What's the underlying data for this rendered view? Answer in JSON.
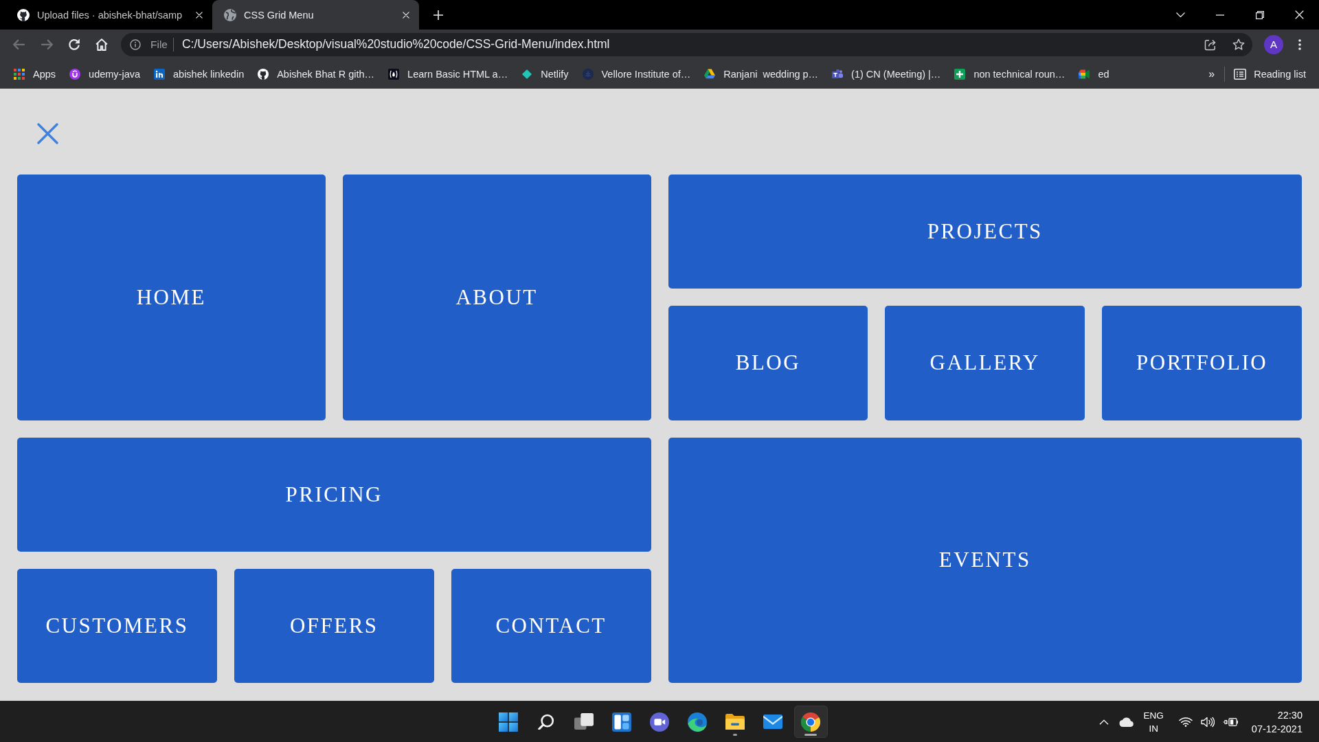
{
  "browser": {
    "tabs": [
      {
        "title": "Upload files · abishek-bhat/samp",
        "selected": false
      },
      {
        "title": "CSS Grid Menu",
        "selected": true
      }
    ],
    "toolbar": {
      "nav": [
        {
          "disabled": true
        },
        {
          "disabled": true
        },
        {
          "disabled": false
        },
        {
          "disabled": false
        }
      ],
      "address": {
        "scheme": "File",
        "url": "C:/Users/Abishek/Desktop/visual%20studio%20code/CSS-Grid-Menu/index.html"
      },
      "profile_initial": "A"
    },
    "bookmarks": {
      "items": [
        "Apps",
        "udemy-java",
        "abishek linkedin",
        "Abishek Bhat R gith…",
        "Learn Basic HTML a…",
        "Netlify",
        "Vellore Institute of…",
        "Ranjani  wedding p…",
        "(1) CN (Meeting) |…",
        "non technical roun…",
        "ed"
      ],
      "overflow": "»",
      "reading_list": "Reading list"
    }
  },
  "page": {
    "menu_items": [
      "HOME",
      "ABOUT",
      "PROJECTS",
      "BLOG",
      "GALLERY",
      "PORTFOLIO",
      "PRICING",
      "EVENTS",
      "CUSTOMERS",
      "OFFERS",
      "CONTACT"
    ]
  },
  "taskbar": {
    "apps": [
      {
        "running": false,
        "selected": false
      },
      {
        "running": false,
        "selected": false
      },
      {
        "running": false,
        "selected": false
      },
      {
        "running": false,
        "selected": false
      },
      {
        "running": false,
        "selected": false
      },
      {
        "running": false,
        "selected": false
      },
      {
        "running": true,
        "selected": false
      },
      {
        "running": false,
        "selected": false
      },
      {
        "running": true,
        "selected": true
      }
    ],
    "tray": {
      "language": "ENG",
      "region": "IN",
      "time": "22:30",
      "date": "07-12-2021"
    }
  }
}
